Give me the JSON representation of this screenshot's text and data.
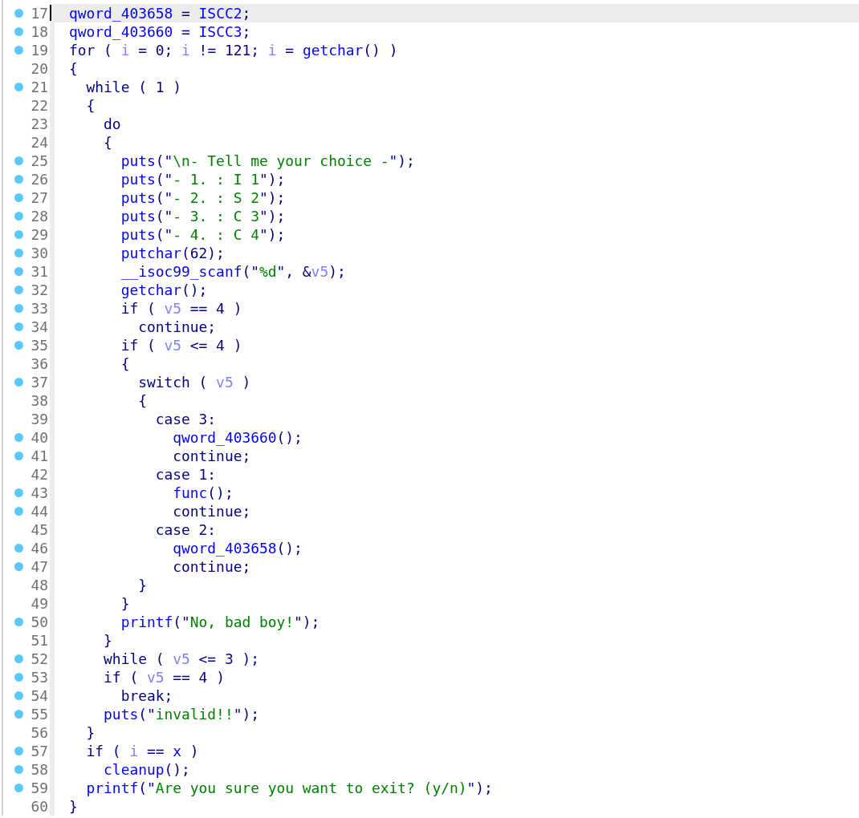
{
  "lines": [
    {
      "number": "17",
      "dot": true,
      "selected": true,
      "tokens": [
        {
          "kind": "name",
          "text": "qword_403658"
        },
        {
          "kind": "plain",
          "text": " = "
        },
        {
          "kind": "name",
          "text": "ISCC2"
        },
        {
          "kind": "plain",
          "text": ";"
        }
      ]
    },
    {
      "number": "18",
      "dot": true,
      "selected": false,
      "tokens": [
        {
          "kind": "name",
          "text": "qword_403660"
        },
        {
          "kind": "plain",
          "text": " = "
        },
        {
          "kind": "name",
          "text": "ISCC3"
        },
        {
          "kind": "plain",
          "text": ";"
        }
      ]
    },
    {
      "number": "19",
      "dot": true,
      "selected": false,
      "tokens": [
        {
          "kind": "plain",
          "text": "for ( "
        },
        {
          "kind": "var",
          "text": "i"
        },
        {
          "kind": "plain",
          "text": " = 0; "
        },
        {
          "kind": "var",
          "text": "i"
        },
        {
          "kind": "plain",
          "text": " != 121; "
        },
        {
          "kind": "var",
          "text": "i"
        },
        {
          "kind": "plain",
          "text": " = "
        },
        {
          "kind": "name",
          "text": "getchar"
        },
        {
          "kind": "plain",
          "text": "() )"
        }
      ]
    },
    {
      "number": "20",
      "dot": false,
      "selected": false,
      "tokens": [
        {
          "kind": "plain",
          "text": "{"
        }
      ]
    },
    {
      "number": "21",
      "dot": true,
      "selected": false,
      "tokens": [
        {
          "kind": "plain",
          "text": "  while ( 1 )"
        }
      ]
    },
    {
      "number": "22",
      "dot": false,
      "selected": false,
      "tokens": [
        {
          "kind": "plain",
          "text": "  {"
        }
      ]
    },
    {
      "number": "23",
      "dot": false,
      "selected": false,
      "tokens": [
        {
          "kind": "plain",
          "text": "    do"
        }
      ]
    },
    {
      "number": "24",
      "dot": false,
      "selected": false,
      "tokens": [
        {
          "kind": "plain",
          "text": "    {"
        }
      ]
    },
    {
      "number": "25",
      "dot": true,
      "selected": false,
      "tokens": [
        {
          "kind": "name",
          "text": "      puts"
        },
        {
          "kind": "plain",
          "text": "(\""
        },
        {
          "kind": "str",
          "text": "\\n- Tell me your choice -"
        },
        {
          "kind": "plain",
          "text": "\");"
        }
      ]
    },
    {
      "number": "26",
      "dot": true,
      "selected": false,
      "tokens": [
        {
          "kind": "name",
          "text": "      puts"
        },
        {
          "kind": "plain",
          "text": "(\""
        },
        {
          "kind": "str",
          "text": "- 1. : I 1"
        },
        {
          "kind": "plain",
          "text": "\");"
        }
      ]
    },
    {
      "number": "27",
      "dot": true,
      "selected": false,
      "tokens": [
        {
          "kind": "name",
          "text": "      puts"
        },
        {
          "kind": "plain",
          "text": "(\""
        },
        {
          "kind": "str",
          "text": "- 2. : S 2"
        },
        {
          "kind": "plain",
          "text": "\");"
        }
      ]
    },
    {
      "number": "28",
      "dot": true,
      "selected": false,
      "tokens": [
        {
          "kind": "name",
          "text": "      puts"
        },
        {
          "kind": "plain",
          "text": "(\""
        },
        {
          "kind": "str",
          "text": "- 3. : C 3"
        },
        {
          "kind": "plain",
          "text": "\");"
        }
      ]
    },
    {
      "number": "29",
      "dot": true,
      "selected": false,
      "tokens": [
        {
          "kind": "name",
          "text": "      puts"
        },
        {
          "kind": "plain",
          "text": "(\""
        },
        {
          "kind": "str",
          "text": "- 4. : C 4"
        },
        {
          "kind": "plain",
          "text": "\");"
        }
      ]
    },
    {
      "number": "30",
      "dot": true,
      "selected": false,
      "tokens": [
        {
          "kind": "name",
          "text": "      putchar"
        },
        {
          "kind": "plain",
          "text": "(62);"
        }
      ]
    },
    {
      "number": "31",
      "dot": true,
      "selected": false,
      "tokens": [
        {
          "kind": "name",
          "text": "      __isoc99_scanf"
        },
        {
          "kind": "plain",
          "text": "(\""
        },
        {
          "kind": "str",
          "text": "%d"
        },
        {
          "kind": "plain",
          "text": "\", &"
        },
        {
          "kind": "var",
          "text": "v5"
        },
        {
          "kind": "plain",
          "text": ");"
        }
      ]
    },
    {
      "number": "32",
      "dot": true,
      "selected": false,
      "tokens": [
        {
          "kind": "name",
          "text": "      getchar"
        },
        {
          "kind": "plain",
          "text": "();"
        }
      ]
    },
    {
      "number": "33",
      "dot": true,
      "selected": false,
      "tokens": [
        {
          "kind": "plain",
          "text": "      if ( "
        },
        {
          "kind": "var",
          "text": "v5"
        },
        {
          "kind": "plain",
          "text": " == 4 )"
        }
      ]
    },
    {
      "number": "34",
      "dot": true,
      "selected": false,
      "tokens": [
        {
          "kind": "plain",
          "text": "        continue;"
        }
      ]
    },
    {
      "number": "35",
      "dot": true,
      "selected": false,
      "tokens": [
        {
          "kind": "plain",
          "text": "      if ( "
        },
        {
          "kind": "var",
          "text": "v5"
        },
        {
          "kind": "plain",
          "text": " <= 4 )"
        }
      ]
    },
    {
      "number": "36",
      "dot": false,
      "selected": false,
      "tokens": [
        {
          "kind": "plain",
          "text": "      {"
        }
      ]
    },
    {
      "number": "37",
      "dot": true,
      "selected": false,
      "tokens": [
        {
          "kind": "plain",
          "text": "        switch ( "
        },
        {
          "kind": "var",
          "text": "v5"
        },
        {
          "kind": "plain",
          "text": " )"
        }
      ]
    },
    {
      "number": "38",
      "dot": false,
      "selected": false,
      "tokens": [
        {
          "kind": "plain",
          "text": "        {"
        }
      ]
    },
    {
      "number": "39",
      "dot": false,
      "selected": false,
      "tokens": [
        {
          "kind": "plain",
          "text": "          case 3:"
        }
      ]
    },
    {
      "number": "40",
      "dot": true,
      "selected": false,
      "tokens": [
        {
          "kind": "name",
          "text": "            qword_403660"
        },
        {
          "kind": "plain",
          "text": "();"
        }
      ]
    },
    {
      "number": "41",
      "dot": true,
      "selected": false,
      "tokens": [
        {
          "kind": "plain",
          "text": "            continue;"
        }
      ]
    },
    {
      "number": "42",
      "dot": false,
      "selected": false,
      "tokens": [
        {
          "kind": "plain",
          "text": "          case 1:"
        }
      ]
    },
    {
      "number": "43",
      "dot": true,
      "selected": false,
      "tokens": [
        {
          "kind": "name",
          "text": "            func"
        },
        {
          "kind": "plain",
          "text": "();"
        }
      ]
    },
    {
      "number": "44",
      "dot": true,
      "selected": false,
      "tokens": [
        {
          "kind": "plain",
          "text": "            continue;"
        }
      ]
    },
    {
      "number": "45",
      "dot": false,
      "selected": false,
      "tokens": [
        {
          "kind": "plain",
          "text": "          case 2:"
        }
      ]
    },
    {
      "number": "46",
      "dot": true,
      "selected": false,
      "tokens": [
        {
          "kind": "name",
          "text": "            qword_403658"
        },
        {
          "kind": "plain",
          "text": "();"
        }
      ]
    },
    {
      "number": "47",
      "dot": true,
      "selected": false,
      "tokens": [
        {
          "kind": "plain",
          "text": "            continue;"
        }
      ]
    },
    {
      "number": "48",
      "dot": false,
      "selected": false,
      "tokens": [
        {
          "kind": "plain",
          "text": "        }"
        }
      ]
    },
    {
      "number": "49",
      "dot": false,
      "selected": false,
      "tokens": [
        {
          "kind": "plain",
          "text": "      }"
        }
      ]
    },
    {
      "number": "50",
      "dot": true,
      "selected": false,
      "tokens": [
        {
          "kind": "name",
          "text": "      printf"
        },
        {
          "kind": "plain",
          "text": "(\""
        },
        {
          "kind": "str",
          "text": "No, bad boy!"
        },
        {
          "kind": "plain",
          "text": "\");"
        }
      ]
    },
    {
      "number": "51",
      "dot": false,
      "selected": false,
      "tokens": [
        {
          "kind": "plain",
          "text": "    }"
        }
      ]
    },
    {
      "number": "52",
      "dot": true,
      "selected": false,
      "tokens": [
        {
          "kind": "plain",
          "text": "    while ( "
        },
        {
          "kind": "var",
          "text": "v5"
        },
        {
          "kind": "plain",
          "text": " <= 3 );"
        }
      ]
    },
    {
      "number": "53",
      "dot": true,
      "selected": false,
      "tokens": [
        {
          "kind": "plain",
          "text": "    if ( "
        },
        {
          "kind": "var",
          "text": "v5"
        },
        {
          "kind": "plain",
          "text": " == 4 )"
        }
      ]
    },
    {
      "number": "54",
      "dot": true,
      "selected": false,
      "tokens": [
        {
          "kind": "plain",
          "text": "      break;"
        }
      ]
    },
    {
      "number": "55",
      "dot": true,
      "selected": false,
      "tokens": [
        {
          "kind": "name",
          "text": "    puts"
        },
        {
          "kind": "plain",
          "text": "(\""
        },
        {
          "kind": "str",
          "text": "invalid!!"
        },
        {
          "kind": "plain",
          "text": "\");"
        }
      ]
    },
    {
      "number": "56",
      "dot": false,
      "selected": false,
      "tokens": [
        {
          "kind": "plain",
          "text": "  }"
        }
      ]
    },
    {
      "number": "57",
      "dot": true,
      "selected": false,
      "tokens": [
        {
          "kind": "plain",
          "text": "  if ( "
        },
        {
          "kind": "var",
          "text": "i"
        },
        {
          "kind": "plain",
          "text": " == "
        },
        {
          "kind": "name",
          "text": "x"
        },
        {
          "kind": "plain",
          "text": " )"
        }
      ]
    },
    {
      "number": "58",
      "dot": true,
      "selected": false,
      "tokens": [
        {
          "kind": "name",
          "text": "    cleanup"
        },
        {
          "kind": "plain",
          "text": "();"
        }
      ]
    },
    {
      "number": "59",
      "dot": true,
      "selected": false,
      "tokens": [
        {
          "kind": "name",
          "text": "  printf"
        },
        {
          "kind": "plain",
          "text": "(\""
        },
        {
          "kind": "str",
          "text": "Are you sure you want to exit? (y/n)"
        },
        {
          "kind": "plain",
          "text": "\");"
        }
      ]
    },
    {
      "number": "60",
      "dot": false,
      "selected": false,
      "tokens": [
        {
          "kind": "plain",
          "text": "}"
        }
      ]
    }
  ]
}
